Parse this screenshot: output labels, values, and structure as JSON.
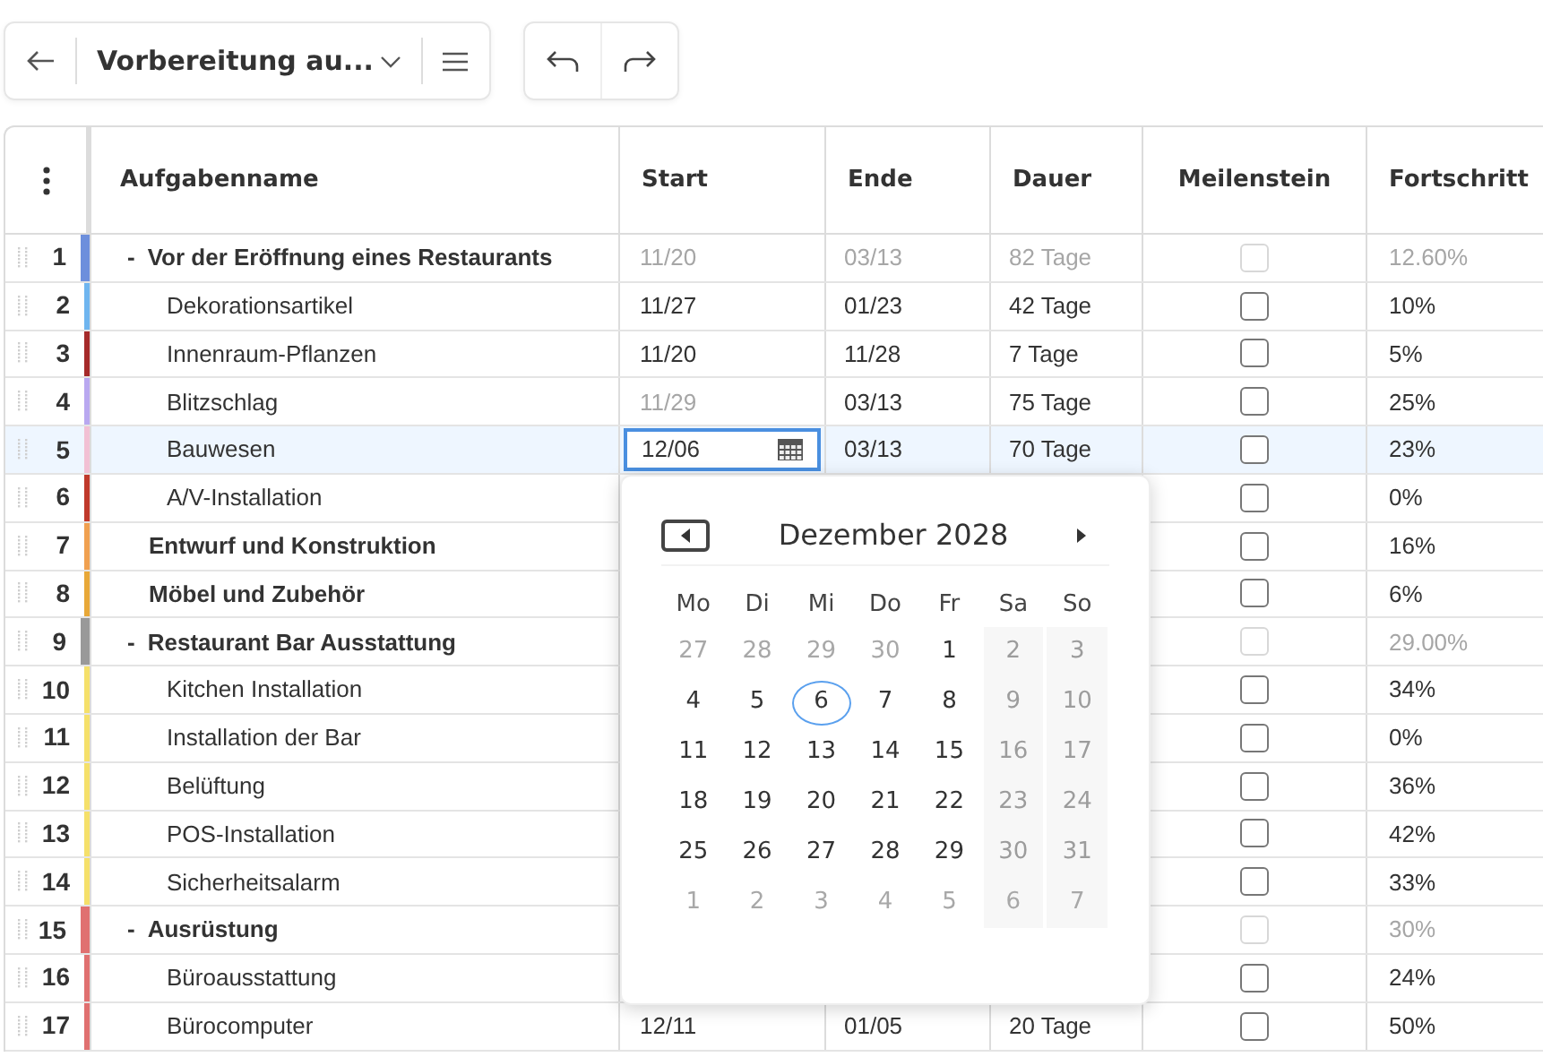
{
  "toolbar": {
    "title": "Vorbereitung au..."
  },
  "table": {
    "columns": [
      "Aufgabenname",
      "Start",
      "Ende",
      "Dauer",
      "Meilenstein",
      "Fortschritt"
    ],
    "rows": [
      {
        "number": "1",
        "kind": "parent",
        "toggle": "-",
        "name": "Vor der Eröffnung eines Restaurants",
        "start": "11/20",
        "end": "03/13",
        "duration": "82 Tage",
        "milestone": false,
        "progress": "12.60%",
        "color": "#6d8fdc",
        "selected": false,
        "start_disabled": true,
        "editing": false
      },
      {
        "number": "2",
        "kind": "task",
        "name": "Dekorationsartikel",
        "start": "11/27",
        "end": "01/23",
        "duration": "42 Tage",
        "milestone": false,
        "progress": "10%",
        "color": "#6fb5ef",
        "selected": false,
        "start_disabled": false,
        "editing": false
      },
      {
        "number": "3",
        "kind": "task",
        "name": "Innenraum-Pflanzen",
        "start": "11/20",
        "end": "11/28",
        "duration": "7 Tage",
        "milestone": false,
        "progress": "5%",
        "color": "#a52a2a",
        "selected": false,
        "start_disabled": false,
        "editing": false
      },
      {
        "number": "4",
        "kind": "task",
        "name": "Blitzschlag",
        "start": "11/29",
        "end": "03/13",
        "duration": "75 Tage",
        "milestone": false,
        "progress": "25%",
        "color": "#b9a8f0",
        "selected": false,
        "start_disabled": true,
        "editing": false
      },
      {
        "number": "5",
        "kind": "task",
        "name": "Bauwesen",
        "start": "12/06",
        "end": "03/13",
        "duration": "70 Tage",
        "milestone": false,
        "progress": "23%",
        "color": "#f2c0d4",
        "selected": true,
        "start_disabled": false,
        "editing": true
      },
      {
        "number": "6",
        "kind": "task",
        "name": "A/V-Installation",
        "milestone": false,
        "progress": "0%",
        "color": "#c0392b",
        "selected": false
      },
      {
        "number": "7",
        "kind": "group",
        "name": "Entwurf und Konstruktion",
        "milestone": false,
        "progress": "16%",
        "color": "#f0a050",
        "selected": false
      },
      {
        "number": "8",
        "kind": "group",
        "name": "Möbel und Zubehör",
        "milestone": false,
        "progress": "6%",
        "color": "#e8a838",
        "selected": false
      },
      {
        "number": "9",
        "kind": "parent",
        "toggle": "-",
        "name": "Restaurant Bar Ausstattung",
        "milestone": false,
        "progress": "29.00%",
        "color": "#999999",
        "selected": false
      },
      {
        "number": "10",
        "kind": "task",
        "name": "Kitchen Installation",
        "milestone": false,
        "progress": "34%",
        "color": "#f5e06a",
        "selected": false
      },
      {
        "number": "11",
        "kind": "task",
        "name": "Installation der Bar",
        "milestone": false,
        "progress": "0%",
        "color": "#f5e06a",
        "selected": false
      },
      {
        "number": "12",
        "kind": "task",
        "name": "Belüftung",
        "milestone": false,
        "progress": "36%",
        "color": "#f5e06a",
        "selected": false
      },
      {
        "number": "13",
        "kind": "task",
        "name": "POS-Installation",
        "milestone": false,
        "progress": "42%",
        "color": "#f5e06a",
        "selected": false
      },
      {
        "number": "14",
        "kind": "task",
        "name": "Sicherheitsalarm",
        "milestone": false,
        "progress": "33%",
        "color": "#f5e06a",
        "selected": false
      },
      {
        "number": "15",
        "kind": "parent",
        "toggle": "-",
        "name": "Ausrüstung",
        "milestone": false,
        "progress": "30%",
        "color": "#e07070",
        "selected": false
      },
      {
        "number": "16",
        "kind": "task",
        "name": "Büroausstattung",
        "milestone": false,
        "progress": "24%",
        "color": "#e07070",
        "selected": false
      },
      {
        "number": "17",
        "kind": "task",
        "name": "Bürocomputer",
        "start": "12/11",
        "end": "01/05",
        "duration": "20 Tage",
        "milestone": false,
        "progress": "50%",
        "color": "#e07070",
        "selected": false,
        "start_disabled": false,
        "editing": false
      }
    ]
  },
  "calendar": {
    "title": "Dezember 2028",
    "weekdays": [
      "Mo",
      "Di",
      "Mi",
      "Do",
      "Fr",
      "Sa",
      "So"
    ],
    "weeks": [
      [
        {
          "day": "27",
          "outside": true,
          "selected": false
        },
        {
          "day": "28",
          "outside": true,
          "selected": false
        },
        {
          "day": "29",
          "outside": true,
          "selected": false
        },
        {
          "day": "30",
          "outside": true,
          "selected": false
        },
        {
          "day": "1",
          "outside": false,
          "selected": false
        },
        {
          "day": "2",
          "outside": false,
          "selected": false
        },
        {
          "day": "3",
          "outside": false,
          "selected": false
        }
      ],
      [
        {
          "day": "4",
          "outside": false,
          "selected": false
        },
        {
          "day": "5",
          "outside": false,
          "selected": false
        },
        {
          "day": "6",
          "outside": false,
          "selected": true
        },
        {
          "day": "7",
          "outside": false,
          "selected": false
        },
        {
          "day": "8",
          "outside": false,
          "selected": false
        },
        {
          "day": "9",
          "outside": false,
          "selected": false
        },
        {
          "day": "10",
          "outside": false,
          "selected": false
        }
      ],
      [
        {
          "day": "11",
          "outside": false,
          "selected": false
        },
        {
          "day": "12",
          "outside": false,
          "selected": false
        },
        {
          "day": "13",
          "outside": false,
          "selected": false
        },
        {
          "day": "14",
          "outside": false,
          "selected": false
        },
        {
          "day": "15",
          "outside": false,
          "selected": false
        },
        {
          "day": "16",
          "outside": false,
          "selected": false
        },
        {
          "day": "17",
          "outside": false,
          "selected": false
        }
      ],
      [
        {
          "day": "18",
          "outside": false,
          "selected": false
        },
        {
          "day": "19",
          "outside": false,
          "selected": false
        },
        {
          "day": "20",
          "outside": false,
          "selected": false
        },
        {
          "day": "21",
          "outside": false,
          "selected": false
        },
        {
          "day": "22",
          "outside": false,
          "selected": false
        },
        {
          "day": "23",
          "outside": false,
          "selected": false
        },
        {
          "day": "24",
          "outside": false,
          "selected": false
        }
      ],
      [
        {
          "day": "25",
          "outside": false,
          "selected": false
        },
        {
          "day": "26",
          "outside": false,
          "selected": false
        },
        {
          "day": "27",
          "outside": false,
          "selected": false
        },
        {
          "day": "28",
          "outside": false,
          "selected": false
        },
        {
          "day": "29",
          "outside": false,
          "selected": false
        },
        {
          "day": "30",
          "outside": false,
          "selected": false
        },
        {
          "day": "31",
          "outside": false,
          "selected": false
        }
      ],
      [
        {
          "day": "1",
          "outside": true,
          "selected": false
        },
        {
          "day": "2",
          "outside": true,
          "selected": false
        },
        {
          "day": "3",
          "outside": true,
          "selected": false
        },
        {
          "day": "4",
          "outside": true,
          "selected": false
        },
        {
          "day": "5",
          "outside": true,
          "selected": false
        },
        {
          "day": "6",
          "outside": true,
          "selected": false
        },
        {
          "day": "7",
          "outside": true,
          "selected": false
        }
      ]
    ]
  }
}
